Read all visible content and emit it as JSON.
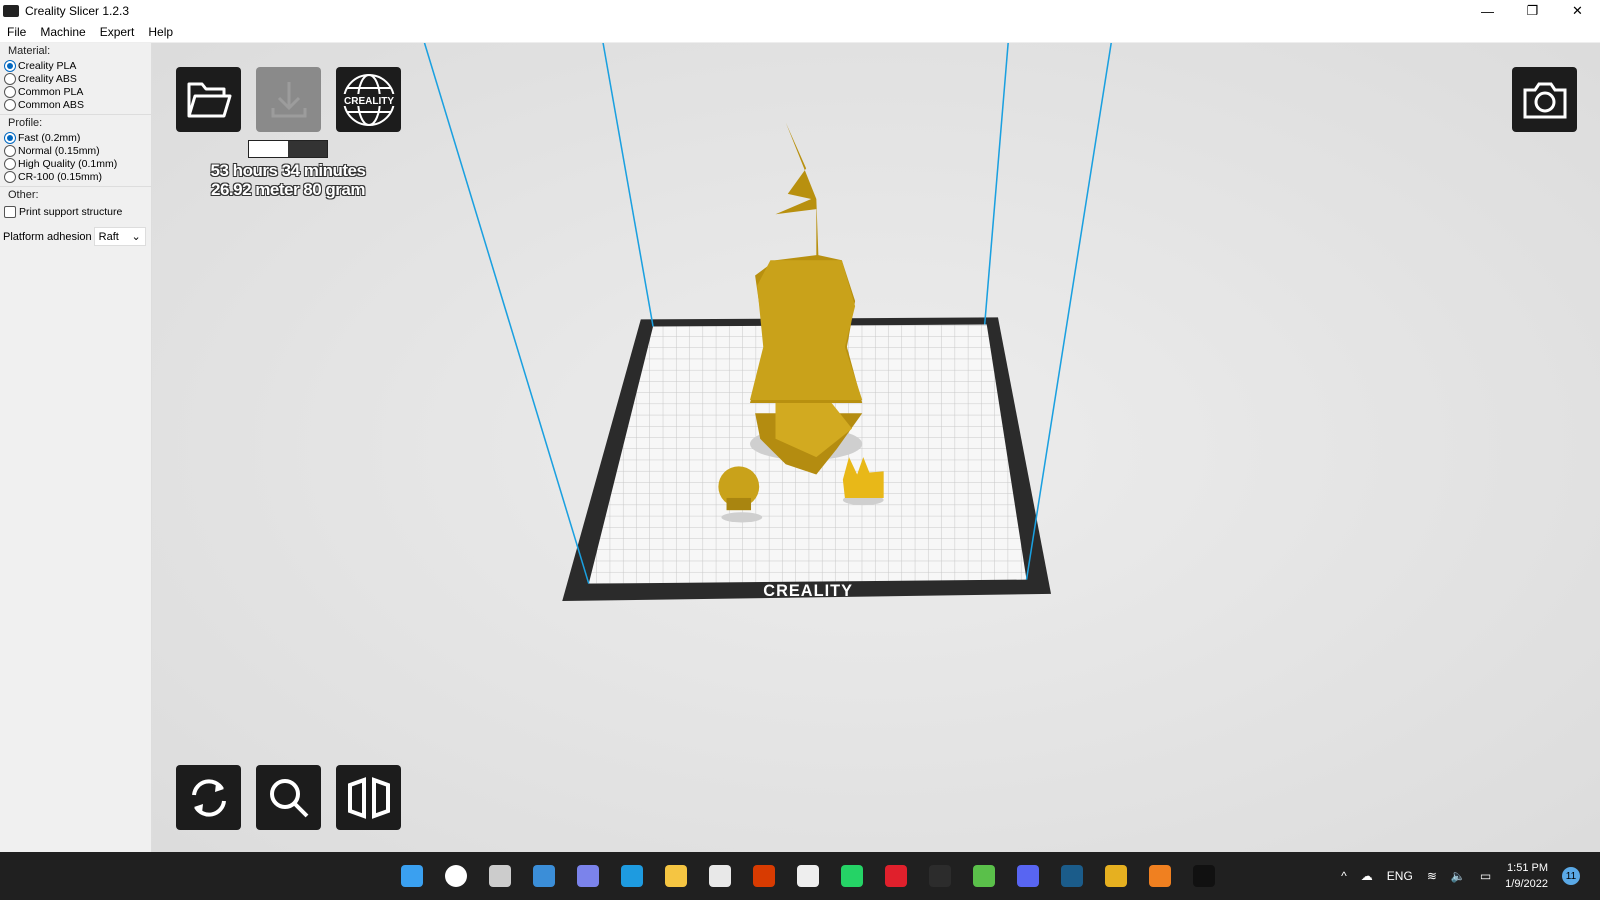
{
  "window": {
    "title": "Creality Slicer 1.2.3",
    "minimize": "—",
    "maximize": "❐",
    "close": "✕"
  },
  "menu": [
    "File",
    "Machine",
    "Expert",
    "Help"
  ],
  "sidebar": {
    "material_label": "Material:",
    "materials": [
      "Creality PLA",
      "Creality ABS",
      "Common PLA",
      "Common ABS"
    ],
    "material_selected": "Creality PLA",
    "profile_label": "Profile:",
    "profiles": [
      "Fast (0.2mm)",
      "Normal (0.15mm)",
      "High Quality (0.1mm)",
      "CR-100 (0.15mm)"
    ],
    "profile_selected": "Fast (0.2mm)",
    "other_label": "Other:",
    "support_label": "Print support structure",
    "support_checked": false,
    "adhesion_label": "Platform adhesion",
    "adhesion_value": "Raft"
  },
  "viewport": {
    "print_time": "53 hours 34 minutes",
    "material_usage": "26.92 meter 80 gram",
    "progress_fraction": 0.5,
    "bed_logo": "CREALITY",
    "web_logo": "CREALITY",
    "model_color": "#c9a21a"
  },
  "taskbar": {
    "icons": [
      "windows-start",
      "search",
      "task-view",
      "widgets",
      "teams-chat",
      "edge",
      "file-explorer",
      "store",
      "office",
      "dropbox",
      "whatsapp",
      "opera",
      "app-green",
      "app-game",
      "discord",
      "steam",
      "chrome",
      "blender",
      "creality-slicer"
    ],
    "language": "ENG",
    "time": "1:51 PM",
    "date": "1/9/2022",
    "notifications": "11"
  }
}
